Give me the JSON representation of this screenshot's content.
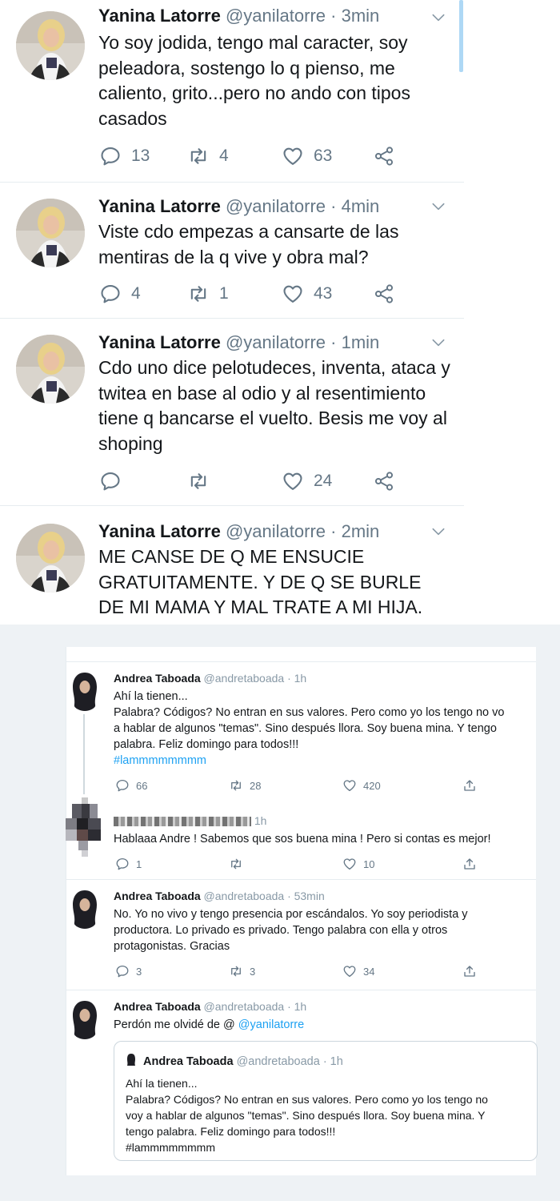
{
  "mobile_tweets": [
    {
      "name": "Yanina Latorre",
      "handle": "@yanilatorre",
      "time": "· 3min",
      "text": "Yo soy jodida, tengo mal caracter, soy peleadora, sostengo lo q pienso, me caliento, grito...pero no ando con tipos casados",
      "replies": "13",
      "retweets": "4",
      "likes": "63"
    },
    {
      "name": "Yanina Latorre",
      "handle": "@yanilatorre",
      "time": "· 4min",
      "text": "Viste cdo empezas a cansarte de las mentiras de la q vive y obra mal?",
      "replies": "4",
      "retweets": "1",
      "likes": "43"
    },
    {
      "name": "Yanina Latorre",
      "handle": "@yanilatorre",
      "time": "· 1min",
      "text": "Cdo uno dice pelotudeces, inventa, ataca y twitea en base al odio y al resentimiento tiene q bancarse el vuelto. Besis me voy al shoping",
      "replies": "",
      "retweets": "",
      "likes": "24"
    },
    {
      "name": "Yanina Latorre",
      "handle": "@yanilatorre",
      "time": "· 2min",
      "text": "ME CANSE DE Q ME ENSUCIE GRATUITAMENTE. Y DE Q SE BURLE DE MI MAMA Y MAL TRATE A MI HIJA."
    }
  ],
  "desktop_tweets": [
    {
      "name": "Andrea Taboada",
      "handle": "@andretaboada",
      "time": "· 1h",
      "text": "Ahí la tienen...\nPalabra? Códigos? No entran en sus valores. Pero como yo los tengo no vo\na hablar de algunos \"temas\". Sino después llora. Soy buena mina. Y tengo\npalabra. Feliz domingo para todos!!!",
      "hashtag": "#lammmmmmmm",
      "replies": "66",
      "retweets": "28",
      "likes": "420"
    },
    {
      "name_censored": "censored-user",
      "time": "1h",
      "text": "Hablaaa Andre ! Sabemos que sos buena mina ! Pero si contas es mejor!",
      "replies": "1",
      "retweets": "",
      "likes": "10"
    },
    {
      "name": "Andrea Taboada",
      "handle": "@andretaboada",
      "time": "· 53min",
      "text": "No. Yo no vivo y tengo presencia por escándalos. Yo soy periodista y\nproductora. Lo privado es privado. Tengo palabra con ella y otros\nprotagonistas. Gracias",
      "replies": "3",
      "retweets": "3",
      "likes": "34"
    },
    {
      "name": "Andrea Taboada",
      "handle": "@andretaboada",
      "time": "· 1h",
      "text": "Perdón me olvidé de @",
      "mention": "@yanilatorre"
    }
  ],
  "quoted_tweet": {
    "name": "Andrea Taboada",
    "handle": "@andretaboada",
    "time": "· 1h",
    "text": "Ahí la tienen...\nPalabra? Códigos? No entran en sus valores. Pero como yo los tengo no\nvoy a hablar de algunos \"temas\". Sino después llora. Soy buena mina. Y\ntengo palabra. Feliz domingo para todos!!!\n#lammmmmmmm"
  },
  "icons": [
    "reply-icon",
    "retweet-icon",
    "like-icon",
    "share-icon",
    "chevron-down-icon",
    "upload-icon"
  ],
  "colors": {
    "name": "#14171a",
    "muted": "#657786",
    "link": "#1da1f2",
    "divider": "#e6ecf0"
  }
}
